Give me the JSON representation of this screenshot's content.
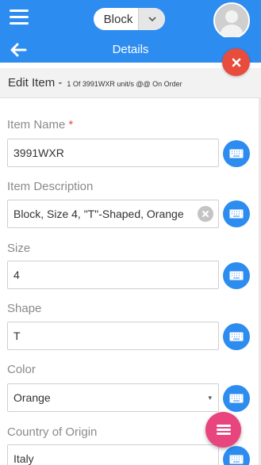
{
  "colors": {
    "primary": "#2d8cf0",
    "danger": "#e84c3d",
    "fab": "#e8457e"
  },
  "topbar": {
    "menu_icon": "hamburger-icon",
    "selector_value": "Block",
    "selector_icon": "chevron-down-icon",
    "avatar_icon": "user-avatar-icon"
  },
  "subbar": {
    "back_icon": "arrow-left-icon",
    "title": "Details",
    "close_icon": "close-icon"
  },
  "header": {
    "title": "Edit Item -",
    "subtitle": "1 Of 3991WXR unit/s @@ On Order"
  },
  "fields": [
    {
      "label": "Item Name",
      "required_mark": "*",
      "value": "3991WXR",
      "kind": "text"
    },
    {
      "label": "Item Description",
      "value": "Block, Size 4, \"T\"-Shaped, Orange",
      "kind": "text-clear"
    },
    {
      "label": "Size",
      "value": "4",
      "kind": "text"
    },
    {
      "label": "Shape",
      "value": "T",
      "kind": "text"
    },
    {
      "label": "Color",
      "value": "Orange",
      "kind": "select",
      "caret": "▾"
    },
    {
      "label": "Country of Origin",
      "value": "Italy",
      "kind": "text"
    }
  ],
  "keyboard_icon": "keyboard-icon",
  "fab_icon": "menu-icon"
}
